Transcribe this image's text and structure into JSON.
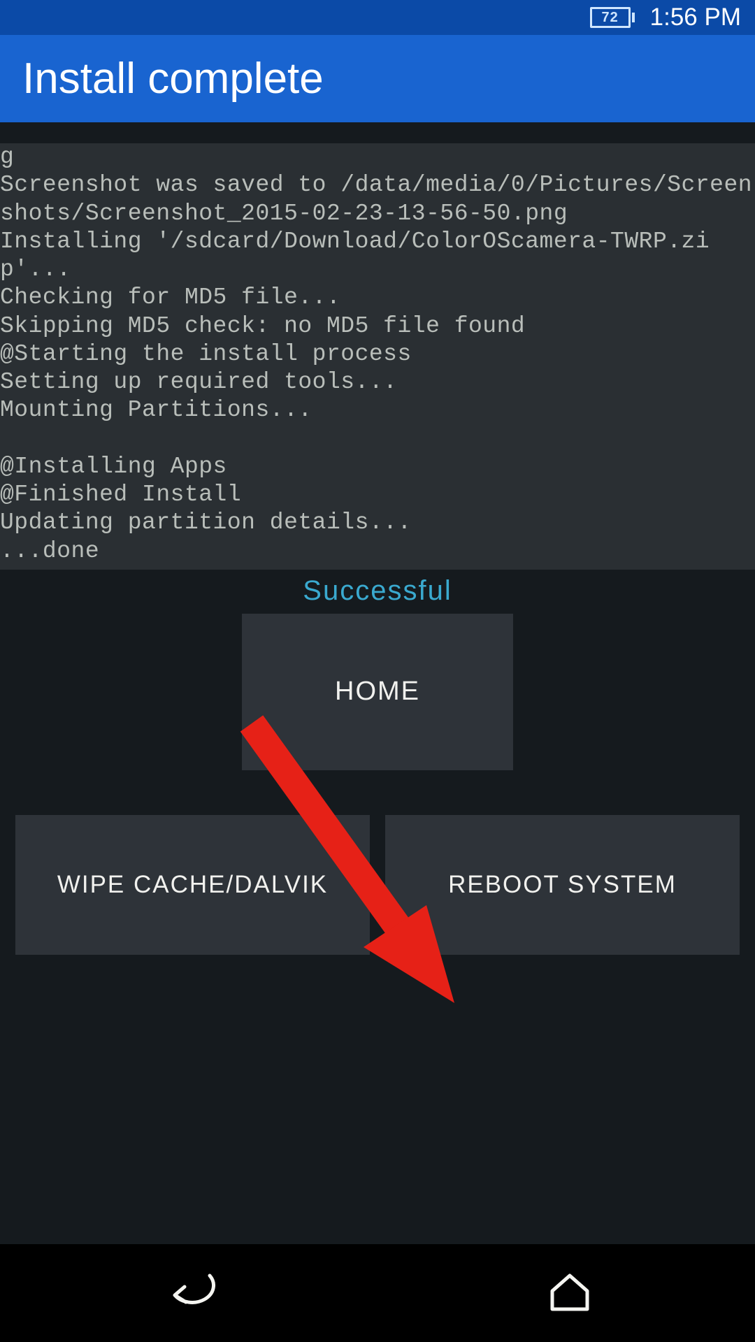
{
  "statusbar": {
    "battery_level": "72",
    "time": "1:56 PM"
  },
  "header": {
    "title": "Install complete"
  },
  "terminal": {
    "log": "g\nScreenshot was saved to /data/media/0/Pictures/Screenshots/Screenshot_2015-02-23-13-56-50.png\nInstalling '/sdcard/Download/ColorOScamera-TWRP.zip'...\nChecking for MD5 file...\nSkipping MD5 check: no MD5 file found\n@Starting the install process\nSetting up required tools...\nMounting Partitions...\n\n@Installing Apps\n@Finished Install\nUpdating partition details...\n...done"
  },
  "status": {
    "label": "Successful"
  },
  "buttons": {
    "home": "HOME",
    "wipe": "WIPE CACHE/DALVIK",
    "reboot": "REBOOT SYSTEM"
  },
  "colors": {
    "accent_status": "#3aa9cf",
    "header_blue": "#1964d0",
    "annotation_red": "#e62117"
  }
}
